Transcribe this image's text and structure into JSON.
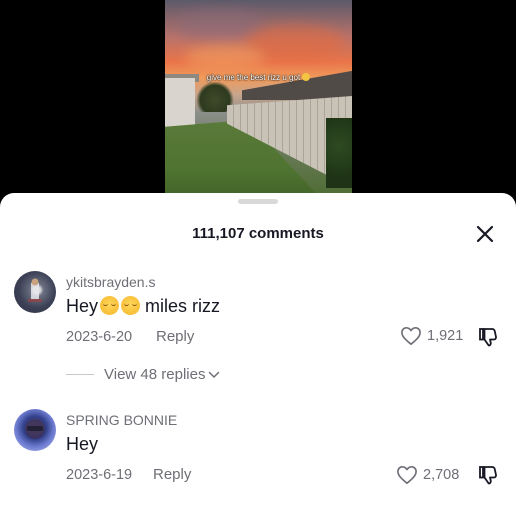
{
  "video": {
    "caption": "give me the best rizz u got"
  },
  "comments_panel": {
    "title": "111,107 comments",
    "comments": [
      {
        "username": "ykitsbrayden.s",
        "text_before": "Hey",
        "text_after": " miles rizz",
        "date": "2023-6-20",
        "reply_label": "Reply",
        "likes": "1,921",
        "view_replies_label": "View 48 replies"
      },
      {
        "username": "SPRING BONNIE",
        "text_before": "Hey",
        "text_after": "",
        "date": "2023-6-19",
        "reply_label": "Reply",
        "likes": "2,708"
      }
    ]
  },
  "colors": {
    "primary_text": "#161823",
    "secondary_text": "#6e6f76",
    "sheet_background": "#ffffff",
    "page_background": "#000000"
  }
}
